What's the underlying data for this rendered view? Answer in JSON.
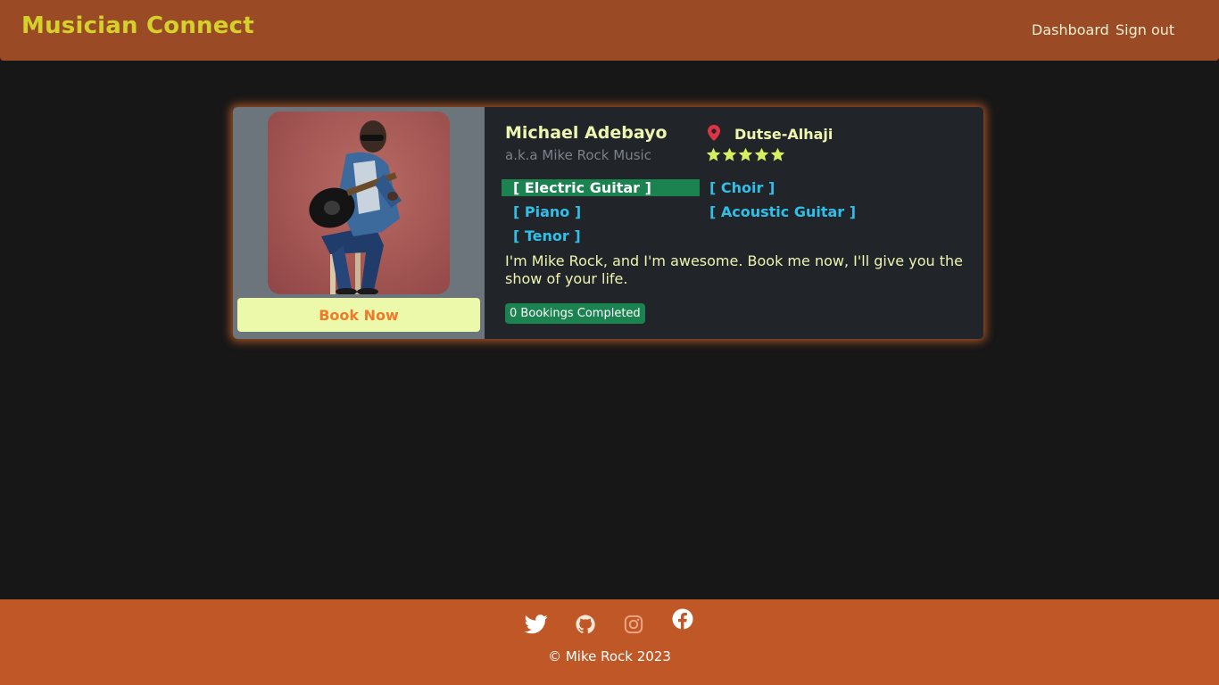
{
  "header": {
    "brand": "Musician Connect",
    "nav": {
      "dashboard": "Dashboard",
      "signout": "Sign out"
    }
  },
  "profile": {
    "name": "Michael Adebayo",
    "alias": "a.k.a Mike Rock Music",
    "location": "Dutse-Alhaji",
    "rating": 5,
    "skills": [
      "[ Electric Guitar ]",
      "[ Choir ]",
      "[ Piano ]",
      "[ Acoustic Guitar ]",
      "[ Tenor ]"
    ],
    "active_skill": "[ Electric Guitar ]",
    "bio": "I'm Mike Rock, and I'm awesome. Book me now, I'll give you the show of your life.",
    "bookings_badge": "0 Bookings Completed",
    "book_button": "Book Now"
  },
  "footer": {
    "icons": [
      "twitter-icon",
      "github-icon",
      "instagram-icon",
      "facebook-icon"
    ],
    "copyright": "© Mike Rock 2023"
  },
  "colors": {
    "header_bg": "#9a4a25",
    "footer_bg": "#c05727",
    "brand": "#d4d22a",
    "active_tag": "#1a8350",
    "tag_text": "#2fc0ea",
    "star": "#d8f060",
    "book_button_bg": "#edf9aa",
    "book_button_text": "#f07a2a"
  }
}
